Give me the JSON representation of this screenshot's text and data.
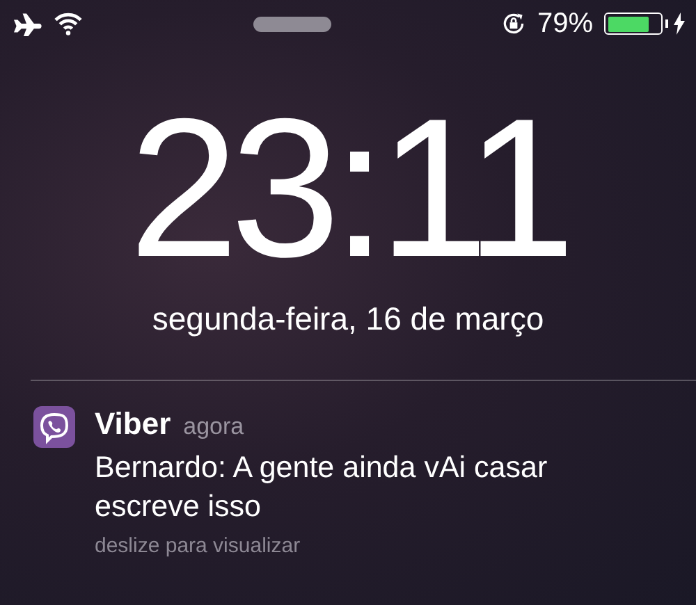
{
  "status_bar": {
    "airplane_mode": true,
    "wifi": true,
    "rotation_lock": true,
    "battery_percent": "79%",
    "battery": {
      "level": 0.79,
      "charging": true
    }
  },
  "lock_screen": {
    "time": "23:11",
    "date": "segunda-feira, 16 de março"
  },
  "notifications": [
    {
      "app": "Viber",
      "time": "agora",
      "message": "Bernardo: A gente ainda vAi casar escreve isso",
      "hint": "deslize para visualizar"
    }
  ]
}
